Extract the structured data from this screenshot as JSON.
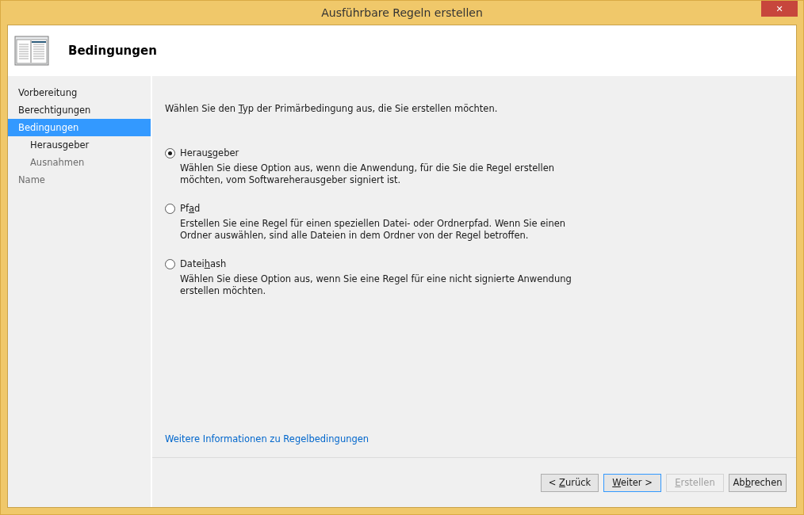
{
  "window": {
    "title": "Ausführbare Regeln erstellen",
    "close": "✕"
  },
  "header": {
    "title": "Bedingungen"
  },
  "sidebar": {
    "items": [
      {
        "label": "Vorbereitung",
        "selected": false,
        "disabled": false
      },
      {
        "label": "Berechtigungen",
        "selected": false,
        "disabled": false
      },
      {
        "label": "Bedingungen",
        "selected": true,
        "disabled": false,
        "children": [
          {
            "label": "Herausgeber",
            "selected": false,
            "disabled": false
          },
          {
            "label": "Ausnahmen",
            "selected": false,
            "disabled": true
          }
        ]
      },
      {
        "label": "Name",
        "selected": false,
        "disabled": true
      }
    ]
  },
  "prompt": [
    "Wählen Sie den ",
    "T",
    "yp der Primärbedingung aus, die Sie erstellen möchten."
  ],
  "options": [
    {
      "label": [
        "Herau",
        "s",
        "geber"
      ],
      "selected": true,
      "description": "Wählen Sie diese Option aus, wenn die Anwendung, für die Sie die Regel erstellen möchten, vom Softwareherausgeber signiert ist."
    },
    {
      "label": [
        "Pf",
        "a",
        "d"
      ],
      "selected": false,
      "description": "Erstellen Sie eine Regel für einen speziellen Datei- oder Ordnerpfad. Wenn Sie einen Ordner auswählen, sind alle Dateien in dem Ordner von der Regel betroffen."
    },
    {
      "label": [
        "Datei",
        "h",
        "ash"
      ],
      "selected": false,
      "description": "Wählen Sie diese Option aus, wenn Sie eine Regel für eine nicht signierte Anwendung erstellen möchten."
    }
  ],
  "more_info_link": "Weitere Informationen zu Regelbedingungen",
  "buttons": [
    {
      "label": {
        "before": "< ",
        "key": "Z",
        "after": "urück"
      },
      "disabled": false,
      "focused": false
    },
    {
      "label": {
        "key": "W",
        "after": "eiter >"
      },
      "disabled": false,
      "focused": true
    },
    {
      "label": {
        "key": "E",
        "after": "rstellen"
      },
      "disabled": true,
      "focused": false
    },
    {
      "label": {
        "before": "Ab",
        "key": "b",
        "after": "rechen"
      },
      "disabled": false,
      "focused": false
    }
  ]
}
